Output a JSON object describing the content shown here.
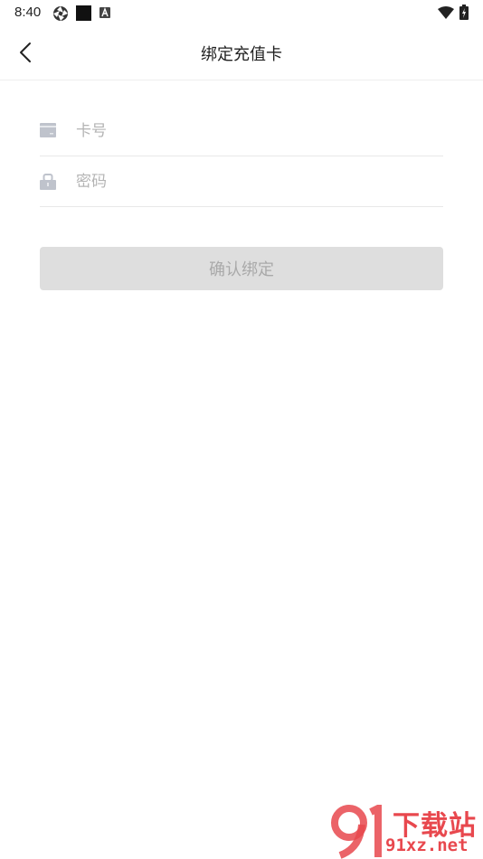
{
  "status_bar": {
    "time": "8:40",
    "icons": [
      "aperture-icon",
      "black-square-icon",
      "a-badge-icon",
      "wifi-icon",
      "battery-icon"
    ]
  },
  "nav": {
    "title": "绑定充值卡",
    "back_icon": "chevron-left-icon"
  },
  "form": {
    "card_number": {
      "placeholder": "卡号",
      "value": "",
      "icon": "card-icon"
    },
    "password": {
      "placeholder": "密码",
      "value": "",
      "icon": "lock-icon"
    },
    "confirm_label": "确认绑定"
  },
  "watermark": {
    "title": "下载站",
    "url": "91xz.net"
  },
  "colors": {
    "button_bg": "#dedede",
    "button_text": "#a9a9a9",
    "placeholder": "#b4b4b4",
    "watermark": "#e8484e"
  }
}
